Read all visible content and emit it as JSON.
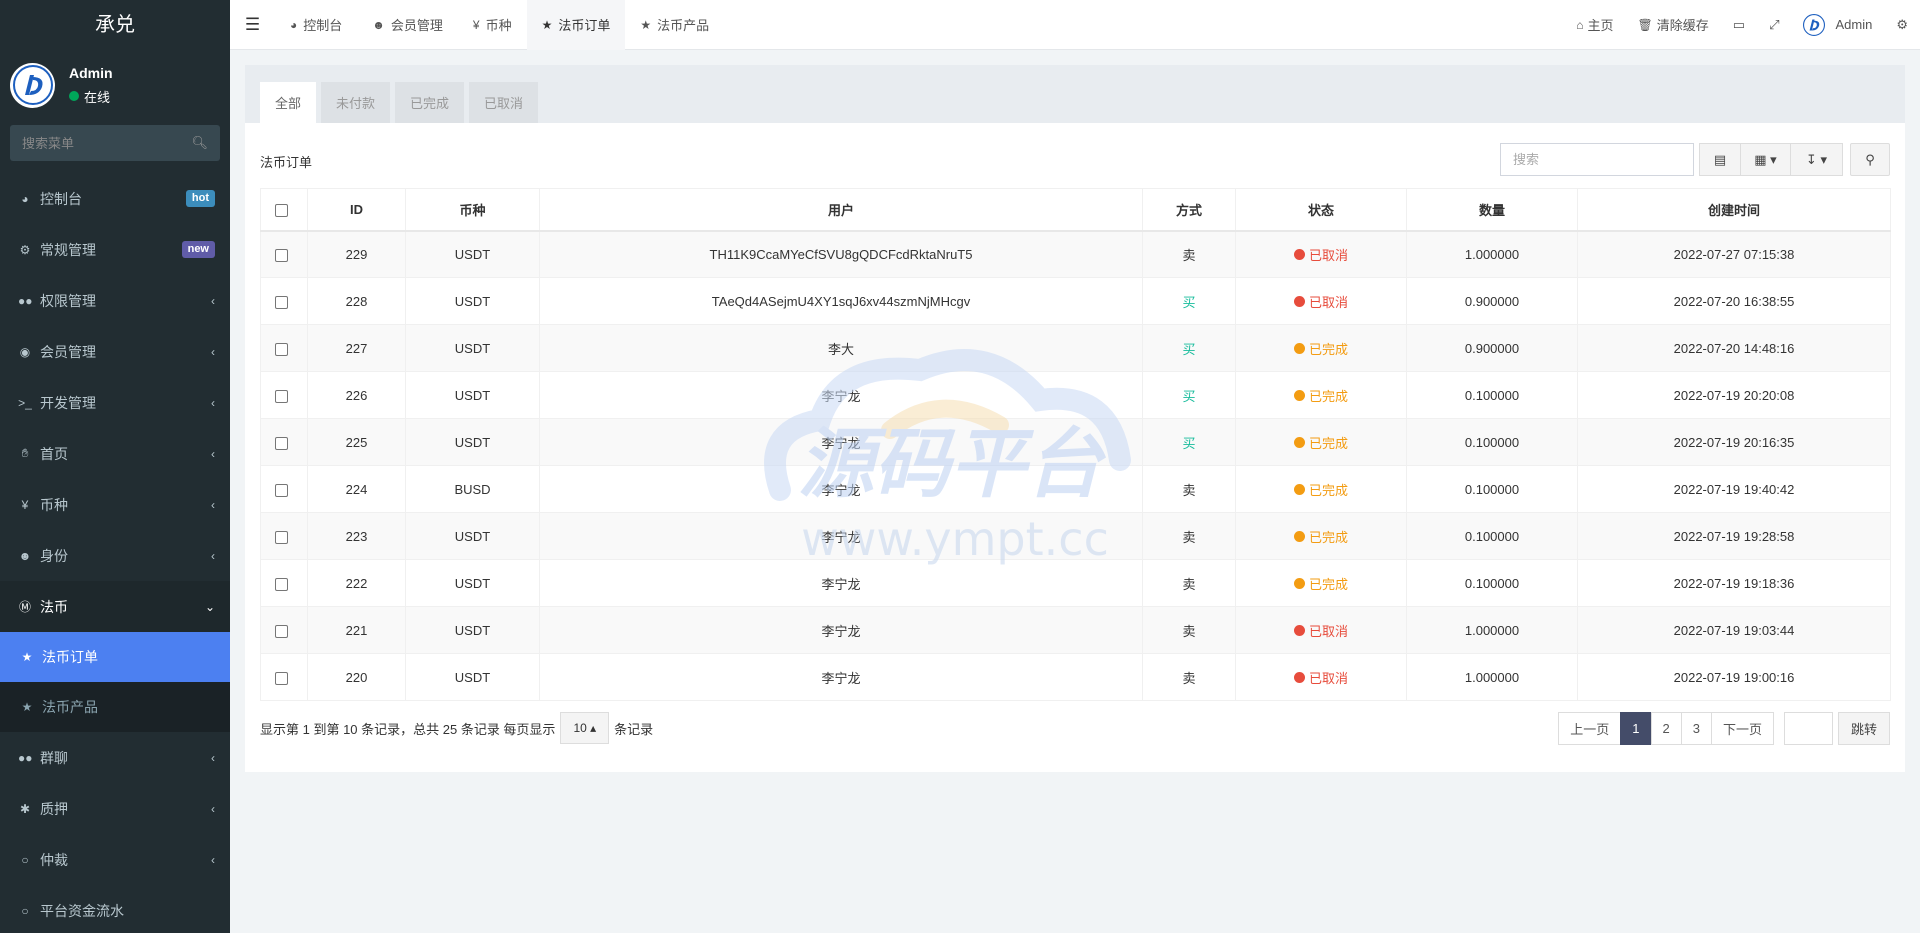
{
  "sidebar": {
    "logo": "承兑",
    "user": {
      "name": "Admin",
      "status": "在线"
    },
    "search_placeholder": "搜索菜单",
    "items": [
      {
        "label": "控制台",
        "icon": "dashboard-icon",
        "badge": "hot"
      },
      {
        "label": "常规管理",
        "icon": "cogs-icon",
        "badge": "new"
      },
      {
        "label": "权限管理",
        "icon": "group-icon"
      },
      {
        "label": "会员管理",
        "icon": "user-circle-icon"
      },
      {
        "label": "开发管理",
        "icon": "terminal-icon"
      },
      {
        "label": "首页",
        "icon": "hand-icon"
      },
      {
        "label": "币种",
        "icon": "yen-icon"
      },
      {
        "label": "身份",
        "icon": "user-icon"
      },
      {
        "label": "法币",
        "icon": "skype-icon"
      }
    ],
    "sub_items": [
      {
        "label": "法币订单",
        "icon": "star-icon"
      },
      {
        "label": "法币产品",
        "icon": "star-icon"
      }
    ],
    "items_after": [
      {
        "label": "群聊",
        "icon": "group-icon"
      },
      {
        "label": "质押",
        "icon": "gear-icon"
      },
      {
        "label": "仲裁",
        "icon": "circle-icon"
      },
      {
        "label": "平台资金流水",
        "icon": "circle-icon"
      }
    ]
  },
  "navbar": {
    "tabs": [
      {
        "label": "控制台",
        "icon": "dashboard-icon"
      },
      {
        "label": "会员管理",
        "icon": "user-icon"
      },
      {
        "label": "币种",
        "icon": "yen-icon"
      },
      {
        "label": "法币订单",
        "icon": "star-icon"
      },
      {
        "label": "法币产品",
        "icon": "star-icon"
      }
    ],
    "right": {
      "home": "主页",
      "clear_cache": "清除缓存",
      "user": "Admin"
    }
  },
  "content": {
    "filter_tabs": [
      "全部",
      "未付款",
      "已完成",
      "已取消"
    ],
    "panel_title": "法币订单",
    "search_placeholder": "搜索",
    "columns": [
      "ID",
      "币种",
      "用户",
      "方式",
      "状态",
      "数量",
      "创建时间"
    ],
    "rows": [
      {
        "id": "229",
        "coin": "USDT",
        "user": "TH11K9CcaMYeCfSVU8gQDCFcdRktaNruT5",
        "method": "卖",
        "status": "已取消",
        "amount": "1.000000",
        "created": "2022-07-27 07:15:38"
      },
      {
        "id": "228",
        "coin": "USDT",
        "user": "TAeQd4ASejmU4XY1sqJ6xv44szmNjMHcgv",
        "method": "买",
        "status": "已取消",
        "amount": "0.900000",
        "created": "2022-07-20 16:38:55"
      },
      {
        "id": "227",
        "coin": "USDT",
        "user": "李大",
        "method": "买",
        "status": "已完成",
        "amount": "0.900000",
        "created": "2022-07-20 14:48:16"
      },
      {
        "id": "226",
        "coin": "USDT",
        "user": "李宁龙",
        "method": "买",
        "status": "已完成",
        "amount": "0.100000",
        "created": "2022-07-19 20:20:08"
      },
      {
        "id": "225",
        "coin": "USDT",
        "user": "李宁龙",
        "method": "买",
        "status": "已完成",
        "amount": "0.100000",
        "created": "2022-07-19 20:16:35"
      },
      {
        "id": "224",
        "coin": "BUSD",
        "user": "李宁龙",
        "method": "卖",
        "status": "已完成",
        "amount": "0.100000",
        "created": "2022-07-19 19:40:42"
      },
      {
        "id": "223",
        "coin": "USDT",
        "user": "李宁龙",
        "method": "卖",
        "status": "已完成",
        "amount": "0.100000",
        "created": "2022-07-19 19:28:58"
      },
      {
        "id": "222",
        "coin": "USDT",
        "user": "李宁龙",
        "method": "卖",
        "status": "已完成",
        "amount": "0.100000",
        "created": "2022-07-19 19:18:36"
      },
      {
        "id": "221",
        "coin": "USDT",
        "user": "李宁龙",
        "method": "卖",
        "status": "已取消",
        "amount": "1.000000",
        "created": "2022-07-19 19:03:44"
      },
      {
        "id": "220",
        "coin": "USDT",
        "user": "李宁龙",
        "method": "卖",
        "status": "已取消",
        "amount": "1.000000",
        "created": "2022-07-19 19:00:16"
      }
    ],
    "pagination": {
      "info_prefix": "显示第 1 到第 10 条记录，总共 25 条记录 每页显示",
      "page_size": "10",
      "info_suffix": "条记录",
      "prev": "上一页",
      "pages": [
        "1",
        "2",
        "3"
      ],
      "next": "下一页",
      "jump": "跳转"
    }
  },
  "watermark": {
    "title": "源码平台",
    "url": "www.ympt.cc"
  },
  "colors": {
    "sidebar_bg": "#222d32",
    "active_blue": "#4c80f1",
    "buy_green": "#18bc9c",
    "cancel_red": "#e74c3c",
    "complete_orange": "#f39c12"
  }
}
